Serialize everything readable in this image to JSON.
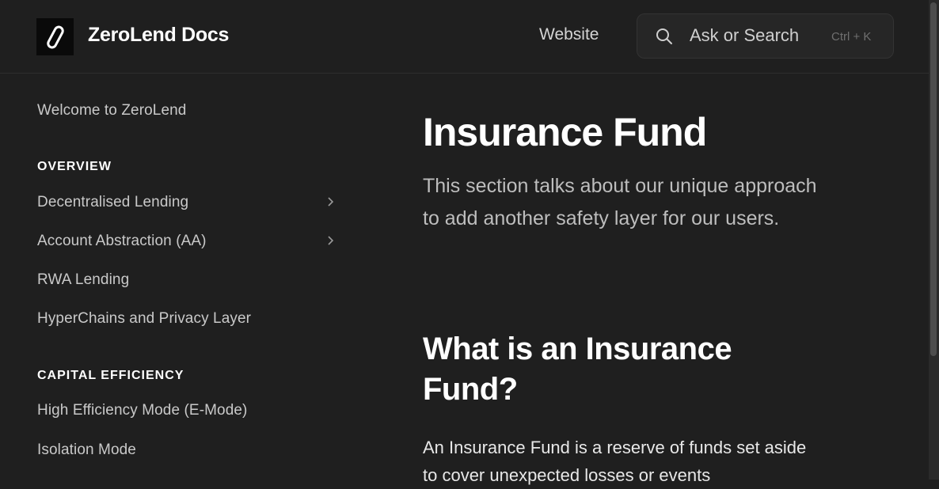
{
  "header": {
    "brand": "ZeroLend Docs",
    "website_label": "Website",
    "search": {
      "placeholder": "Ask or Search",
      "shortcut": "Ctrl + K"
    }
  },
  "sidebar": {
    "welcome": "Welcome to ZeroLend",
    "sections": [
      {
        "heading": "OVERVIEW",
        "items": [
          {
            "label": "Decentralised Lending",
            "expandable": true
          },
          {
            "label": "Account Abstraction (AA)",
            "expandable": true
          },
          {
            "label": "RWA Lending",
            "expandable": false
          },
          {
            "label": "HyperChains and Privacy Layer",
            "expandable": false
          }
        ]
      },
      {
        "heading": "CAPITAL EFFICIENCY",
        "items": [
          {
            "label": "High Efficiency Mode (E-Mode)",
            "expandable": false
          },
          {
            "label": "Isolation Mode",
            "expandable": false
          }
        ]
      }
    ]
  },
  "main": {
    "title": "Insurance Fund",
    "description": "This section talks about our unique approach to add another safety layer for our users.",
    "section_heading": "What is an Insurance Fund?",
    "paragraph": "An Insurance Fund is a reserve of funds set aside to cover unexpected losses or events"
  },
  "icons": {
    "logo": "zerolend-logo-icon",
    "search": "search-icon",
    "chevron": "chevron-right-icon"
  }
}
